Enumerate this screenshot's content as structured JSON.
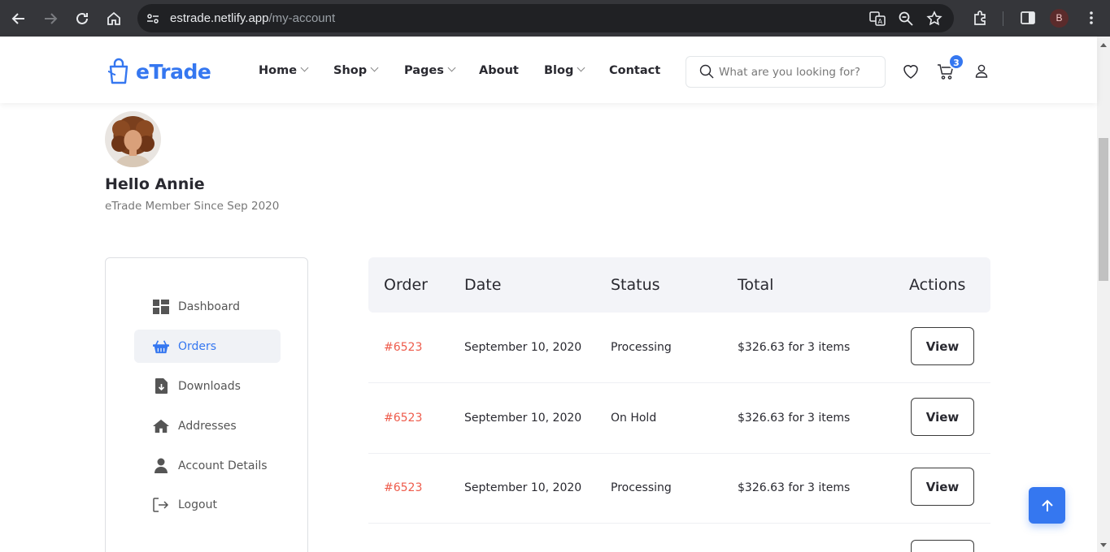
{
  "browser": {
    "url_host": "estrade.netlify.app",
    "url_path": "/my-account",
    "profile_initial": "B"
  },
  "header": {
    "logo_text": "eTrade",
    "nav": [
      {
        "label": "Home",
        "has_dropdown": true
      },
      {
        "label": "Shop",
        "has_dropdown": true
      },
      {
        "label": "Pages",
        "has_dropdown": true
      },
      {
        "label": "About",
        "has_dropdown": false
      },
      {
        "label": "Blog",
        "has_dropdown": true
      },
      {
        "label": "Contact",
        "has_dropdown": false
      }
    ],
    "search_placeholder": "What are you looking for?",
    "cart_count": "3"
  },
  "profile": {
    "greeting": "Hello Annie",
    "member_since": "eTrade Member Since Sep 2020"
  },
  "sidebar": {
    "items": [
      {
        "label": "Dashboard",
        "icon": "dashboard-icon",
        "active": false
      },
      {
        "label": "Orders",
        "icon": "basket-icon",
        "active": true
      },
      {
        "label": "Downloads",
        "icon": "download-file-icon",
        "active": false
      },
      {
        "label": "Addresses",
        "icon": "home-icon",
        "active": false
      },
      {
        "label": "Account Details",
        "icon": "user-icon",
        "active": false
      },
      {
        "label": "Logout",
        "icon": "logout-icon",
        "active": false
      }
    ]
  },
  "orders": {
    "columns": [
      "Order",
      "Date",
      "Status",
      "Total",
      "Actions"
    ],
    "rows": [
      {
        "order": "#6523",
        "date": "September 10, 2020",
        "status": "Processing",
        "total": "$326.63 for 3 items",
        "action": "View"
      },
      {
        "order": "#6523",
        "date": "September 10, 2020",
        "status": "On Hold",
        "total": "$326.63 for 3 items",
        "action": "View"
      },
      {
        "order": "#6523",
        "date": "September 10, 2020",
        "status": "Processing",
        "total": "$326.63 for 3 items",
        "action": "View"
      }
    ]
  },
  "colors": {
    "accent": "#3577f0",
    "order_link": "#ee5b4b",
    "table_head_bg": "#f3f4f8"
  }
}
